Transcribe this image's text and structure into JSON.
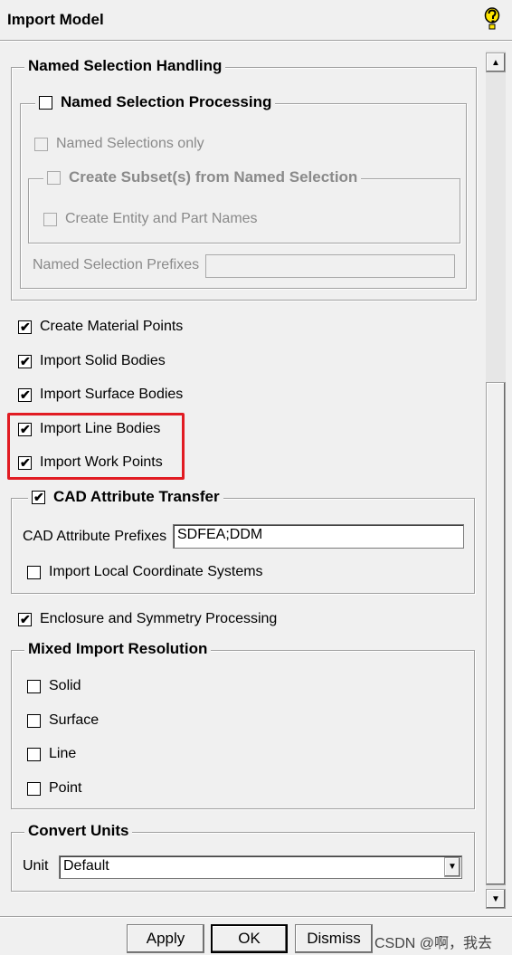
{
  "window": {
    "title": "Import Model",
    "help_icon": "help-question-icon"
  },
  "named_selection": {
    "legend": "Named Selection Handling",
    "processing": {
      "label": "Named Selection Processing",
      "checked": false
    },
    "only": {
      "label": "Named Selections only",
      "checked": false,
      "disabled": true
    },
    "subset": {
      "label": "Create Subset(s) from Named Selection",
      "checked": false,
      "disabled": true,
      "entity_names": {
        "label": "Create Entity and Part Names",
        "checked": false,
        "disabled": true
      }
    },
    "prefixes": {
      "label": "Named Selection Prefixes",
      "value": "",
      "disabled": true
    }
  },
  "options": [
    {
      "label": "Create Material Points",
      "checked": true
    },
    {
      "label": "Import Solid Bodies",
      "checked": true
    },
    {
      "label": "Import Surface Bodies",
      "checked": true
    },
    {
      "label": "Import Line Bodies",
      "checked": true
    },
    {
      "label": "Import Work Points",
      "checked": true
    }
  ],
  "cad": {
    "legend": "CAD Attribute Transfer",
    "checked": true,
    "prefixes_label": "CAD Attribute Prefixes",
    "prefixes_value": "SDFEA;DDM",
    "local_coords": {
      "label": "Import Local Coordinate Systems",
      "checked": false
    }
  },
  "enclosure": {
    "label": "Enclosure and Symmetry Processing",
    "checked": true
  },
  "mixed": {
    "legend": "Mixed Import Resolution",
    "items": [
      {
        "label": "Solid",
        "checked": false
      },
      {
        "label": "Surface",
        "checked": false
      },
      {
        "label": "Line",
        "checked": false
      },
      {
        "label": "Point",
        "checked": false
      }
    ]
  },
  "units": {
    "legend": "Convert Units",
    "unit_label": "Unit",
    "unit_value": "Default"
  },
  "buttons": {
    "apply": "Apply",
    "ok": "OK",
    "dismiss": "Dismiss"
  },
  "watermark": "CSDN @啊，我去",
  "colors": {
    "highlight": "#e11b22"
  }
}
